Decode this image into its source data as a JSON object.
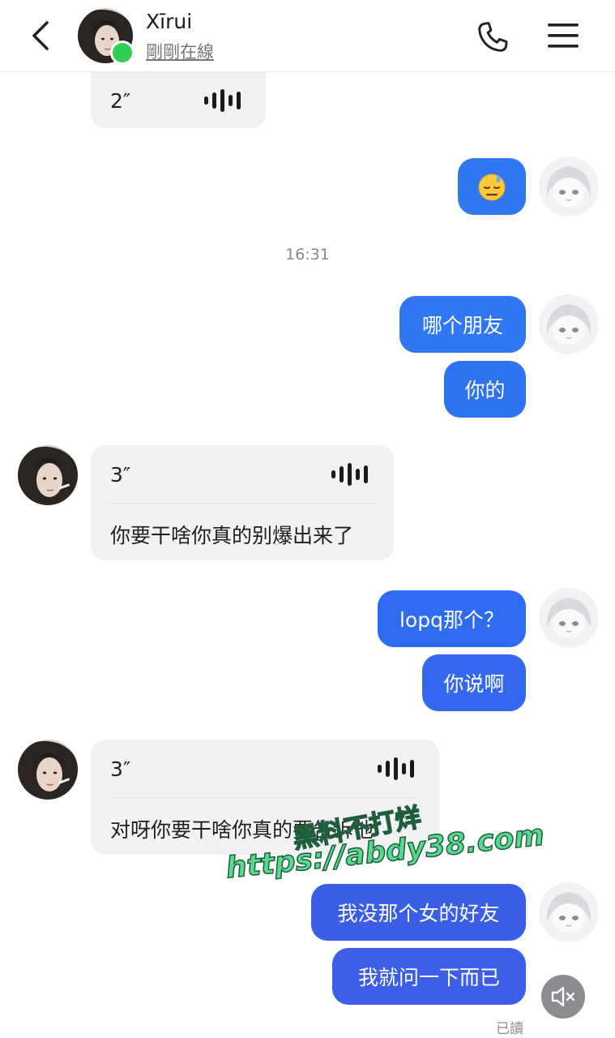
{
  "header": {
    "contact_name": "Xīrui",
    "status": "剛剛在線",
    "back_icon": "chevron-left-icon",
    "call_icon": "phone-icon",
    "menu_icon": "hamburger-menu-icon"
  },
  "messages": {
    "voice_1_duration": "2″",
    "emoji_message": "sweat-face-emoji",
    "timestamp": "16:31",
    "out_1": "哪个朋友",
    "out_2": "你的",
    "voice_2_duration": "3″",
    "voice_2_transcript": "你要干啥你真的别爆出来了",
    "out_3": "lopq那个？",
    "out_4": "你说啊",
    "voice_3_duration": "3″",
    "voice_3_transcript": "对呀你要干啥你真的要告诉他",
    "out_5": "我没那个女的好友",
    "out_6": "我就问一下而已",
    "read_receipt": "已讀"
  },
  "watermark": {
    "line1": "黑料不打烊",
    "line2": "https://abdy38.com"
  },
  "colors": {
    "outgoing_bubble_light": "#2f78f2",
    "outgoing_bubble_dark": "#3d5ee6",
    "incoming_bubble": "#f2f2f4",
    "online": "#2fcf55"
  }
}
